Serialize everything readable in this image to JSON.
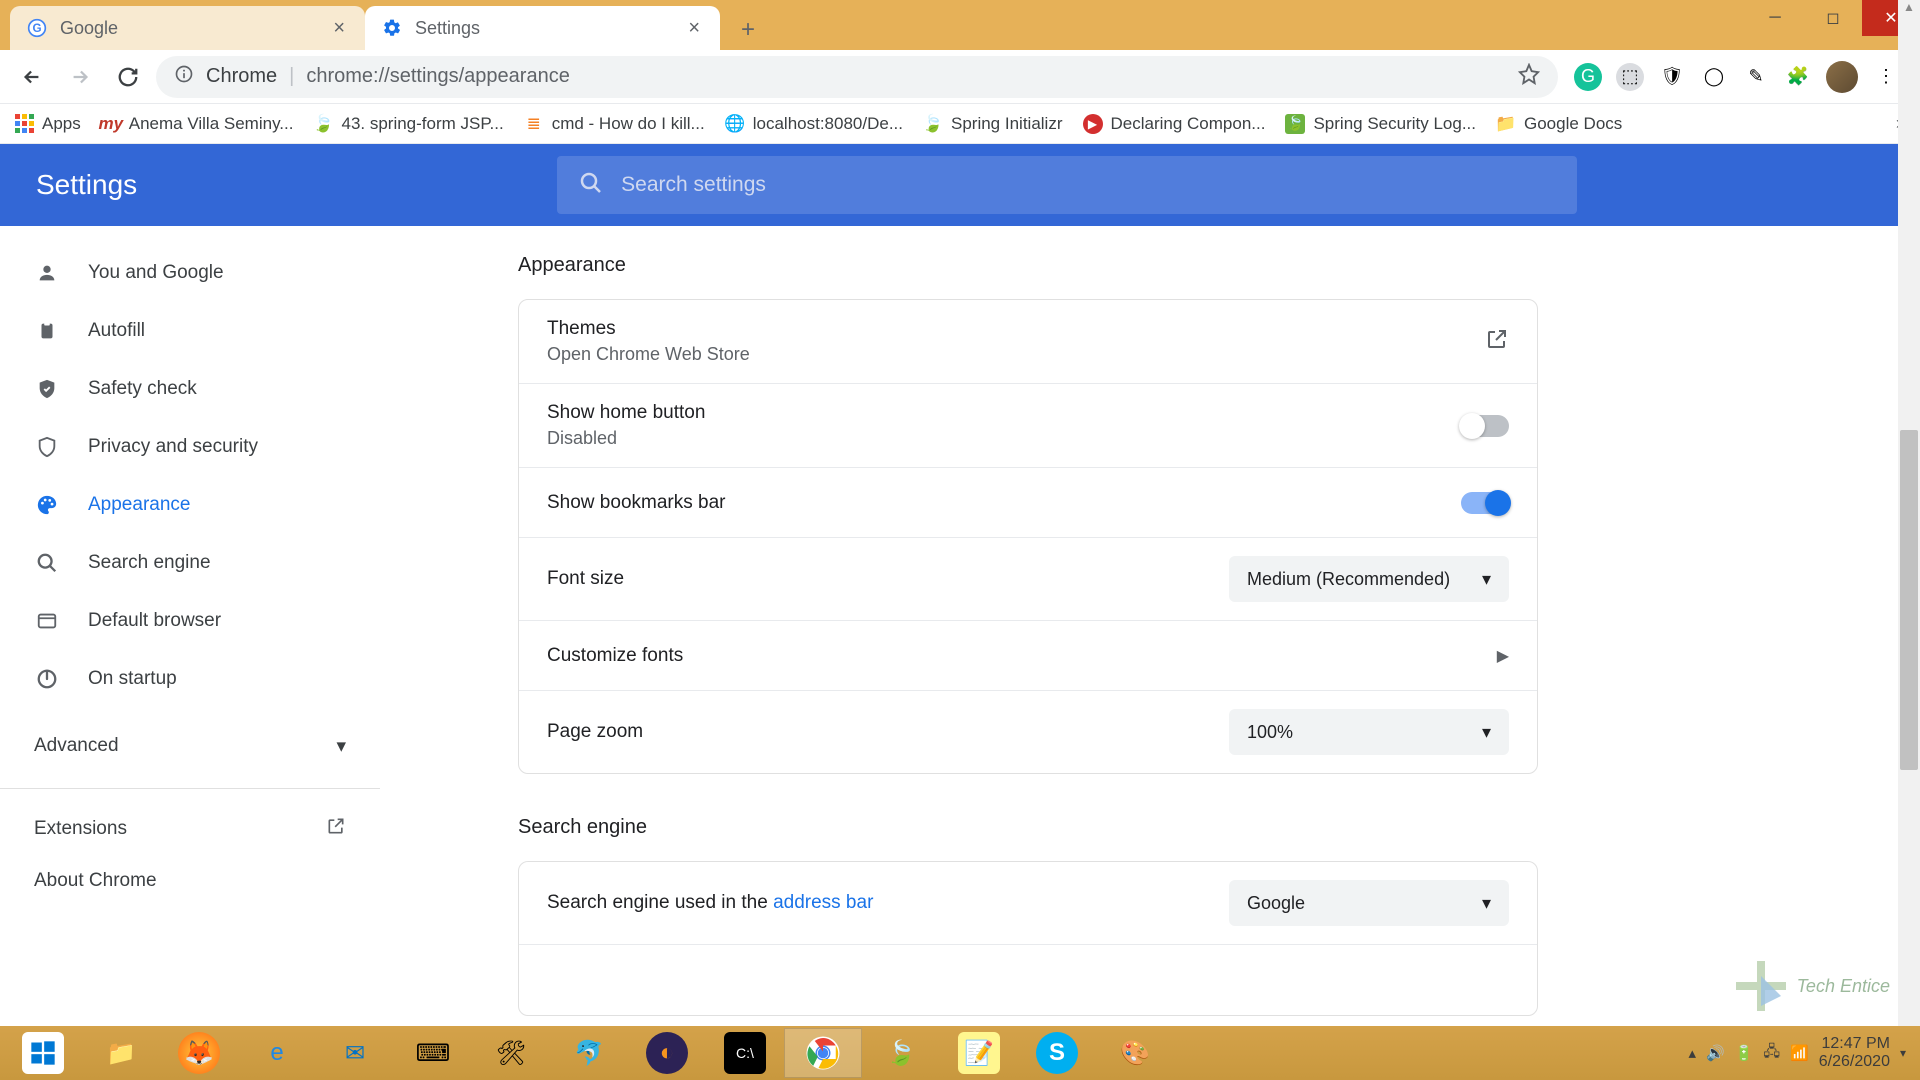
{
  "tabs": [
    {
      "title": "Google",
      "active": false
    },
    {
      "title": "Settings",
      "active": true
    }
  ],
  "address": {
    "scheme": "Chrome",
    "url": "chrome://settings/appearance"
  },
  "bookmarks": [
    {
      "label": "Apps"
    },
    {
      "label": "Anema Villa Seminy..."
    },
    {
      "label": "43. spring-form JSP..."
    },
    {
      "label": "cmd - How do I kill..."
    },
    {
      "label": "localhost:8080/De..."
    },
    {
      "label": "Spring Initializr"
    },
    {
      "label": "Declaring Compon..."
    },
    {
      "label": "Spring Security Log..."
    },
    {
      "label": "Google Docs"
    }
  ],
  "header": {
    "title": "Settings",
    "search_placeholder": "Search settings"
  },
  "sidebar": {
    "items": [
      {
        "label": "You and Google"
      },
      {
        "label": "Autofill"
      },
      {
        "label": "Safety check"
      },
      {
        "label": "Privacy and security"
      },
      {
        "label": "Appearance"
      },
      {
        "label": "Search engine"
      },
      {
        "label": "Default browser"
      },
      {
        "label": "On startup"
      }
    ],
    "advanced": "Advanced",
    "extensions": "Extensions",
    "about": "About Chrome"
  },
  "appearance": {
    "title": "Appearance",
    "themes": {
      "label": "Themes",
      "sub": "Open Chrome Web Store"
    },
    "home": {
      "label": "Show home button",
      "sub": "Disabled"
    },
    "bookmarks": {
      "label": "Show bookmarks bar"
    },
    "fontsize": {
      "label": "Font size",
      "value": "Medium (Recommended)"
    },
    "customize": {
      "label": "Customize fonts"
    },
    "zoom": {
      "label": "Page zoom",
      "value": "100%"
    }
  },
  "search_engine": {
    "title": "Search engine",
    "row1_prefix": "Search engine used in the ",
    "row1_link": "address bar",
    "value": "Google"
  },
  "tray": {
    "time": "12:47 PM",
    "date": "6/26/2020"
  },
  "watermark": "Tech Entice"
}
